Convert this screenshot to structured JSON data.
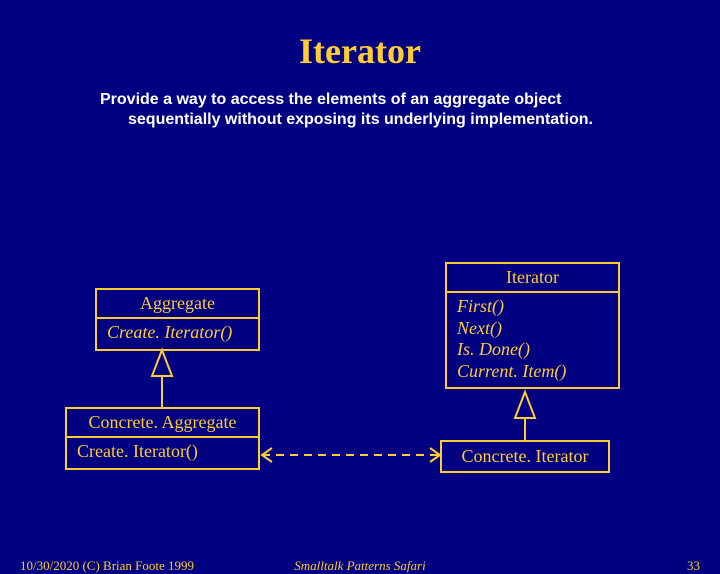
{
  "title": "Iterator",
  "description": "Provide a way to access the elements of an aggregate object sequentially without exposing its underlying implementation.",
  "boxes": {
    "aggregate": {
      "name": "Aggregate",
      "ops": [
        "Create. Iterator()"
      ]
    },
    "iterator": {
      "name": "Iterator",
      "ops": [
        "First()",
        "Next()",
        "Is. Done()",
        "Current. Item()"
      ]
    },
    "concreteAggregate": {
      "name": "Concrete. Aggregate",
      "ops": [
        "Create. Iterator()"
      ]
    },
    "concreteIterator": {
      "name": "Concrete. Iterator"
    }
  },
  "footer": {
    "left": "10/30/2020 (C) Brian Foote 1999",
    "center": "Smalltalk Patterns Safari",
    "right": "33"
  }
}
